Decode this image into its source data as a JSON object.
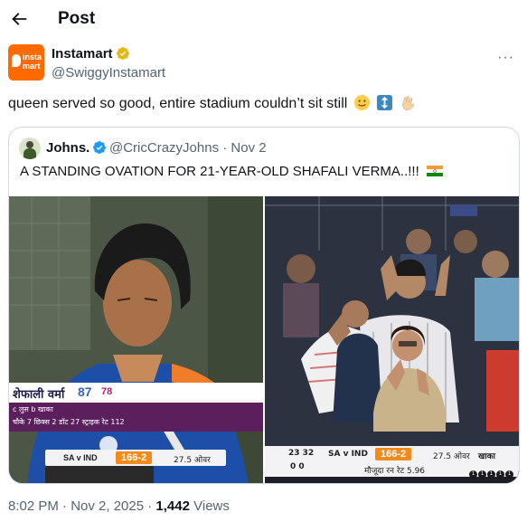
{
  "header": {
    "title": "Post"
  },
  "author": {
    "name": "Instamart",
    "handle": "@SwiggyInstamart",
    "avatar_text": "insta\nmart"
  },
  "post": {
    "text": "queen served so good, entire stadium couldn’t sit still"
  },
  "quote": {
    "name": "Johns.",
    "handle": "@CricCrazyJohns · Nov 2",
    "text": "A STANDING OVATION FOR 21-YEAR-OLD SHAFALI VERMA..!!!"
  },
  "left_scoreboard": {
    "player_name": "शेफाली वर्मा",
    "runs": "87",
    "balls": "78",
    "line1": "c लुस  b खाका",
    "line2": "चौके 7    छिक्स 2    डॉट 27    स्ट्राइक रेट 112",
    "match": "SA v IND",
    "score": "166-2",
    "overs": "27.5 ओवर"
  },
  "right_scoreboard": {
    "left_nums": "23  32",
    "left_nums2": "0   0",
    "match": "SA v IND",
    "score": "166-2",
    "overs": "27.5 ओवर",
    "run_rate": "मौजूदा रन रेट 5.96",
    "bowler": "खाका",
    "balls": [
      "1",
      "1",
      "1",
      "1",
      "1"
    ]
  },
  "footer": {
    "time": "8:02 PM · Nov 2, 2025 · ",
    "views_count": "1,442",
    "views_label": " Views"
  },
  "colors": {
    "accent_orange": "#ff6a00",
    "verified_blue": "#1d9bf0",
    "verified_gold": "#e2b719"
  },
  "icons": [
    "back-arrow-icon",
    "verified-gold-icon",
    "more-icon",
    "verified-blue-icon",
    "india-flag-icon"
  ]
}
